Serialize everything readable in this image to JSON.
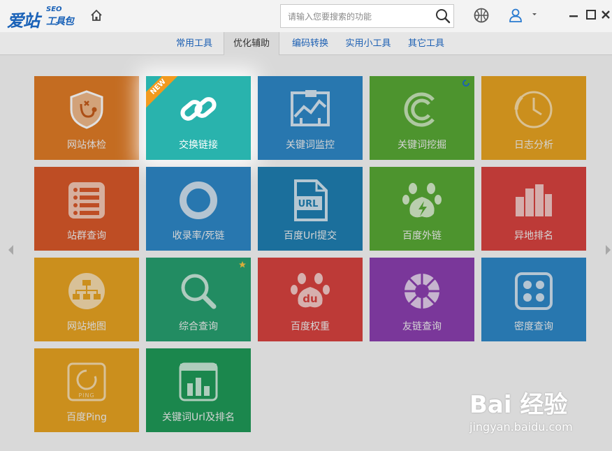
{
  "app": {
    "brand": "爱站",
    "seo": "SEO",
    "sub": "工具包"
  },
  "search": {
    "placeholder": "请输入您要搜索的功能"
  },
  "tabs": [
    {
      "label": "常用工具"
    },
    {
      "label": "优化辅助"
    },
    {
      "label": "编码转换"
    },
    {
      "label": "实用小工具"
    },
    {
      "label": "其它工具"
    }
  ],
  "active_tab": "优化辅助",
  "badges": {
    "new": "NEW"
  },
  "tiles": [
    {
      "label": "网站体检",
      "color": "#e07b26",
      "icon": "shield-stethoscope-icon"
    },
    {
      "label": "交换链接",
      "color": "#29b3ad",
      "icon": "chain-link-icon"
    },
    {
      "label": "关键词监控",
      "color": "#2e88c8",
      "icon": "monitor-chart-icon"
    },
    {
      "label": "关键词挖掘",
      "color": "#58a935",
      "icon": "letter-c-icon"
    },
    {
      "label": "日志分析",
      "color": "#e8a321",
      "icon": "clock-icon"
    },
    {
      "label": "站群查询",
      "color": "#d9582a",
      "icon": "list-icon"
    },
    {
      "label": "收录率/死链",
      "color": "#2e88c8",
      "icon": "ring-icon"
    },
    {
      "label": "百度Url提交",
      "color": "#1f7fb2",
      "icon": "url-file-icon"
    },
    {
      "label": "百度外链",
      "color": "#58a935",
      "icon": "paw-bolt-icon"
    },
    {
      "label": "异地排名",
      "color": "#d8433f",
      "icon": "bar-chart-icon"
    },
    {
      "label": "网站地图",
      "color": "#e8a321",
      "icon": "sitemap-icon"
    },
    {
      "label": "综合查询",
      "color": "#27a070",
      "icon": "magnifier-icon"
    },
    {
      "label": "百度权重",
      "color": "#d8433f",
      "icon": "baidu-paw-icon"
    },
    {
      "label": "友链查询",
      "color": "#8b3fb0",
      "icon": "aperture-icon"
    },
    {
      "label": "密度查询",
      "color": "#2e88c8",
      "icon": "dice-icon"
    },
    {
      "label": "百度Ping",
      "color": "#e8a321",
      "icon": "ping-icon"
    },
    {
      "label": "关键词Url及排名",
      "color": "#1f9a58",
      "icon": "column-chart-icon"
    }
  ],
  "watermark": {
    "top": "Bai 经验",
    "bottom": "jingyan.baidu.com"
  }
}
